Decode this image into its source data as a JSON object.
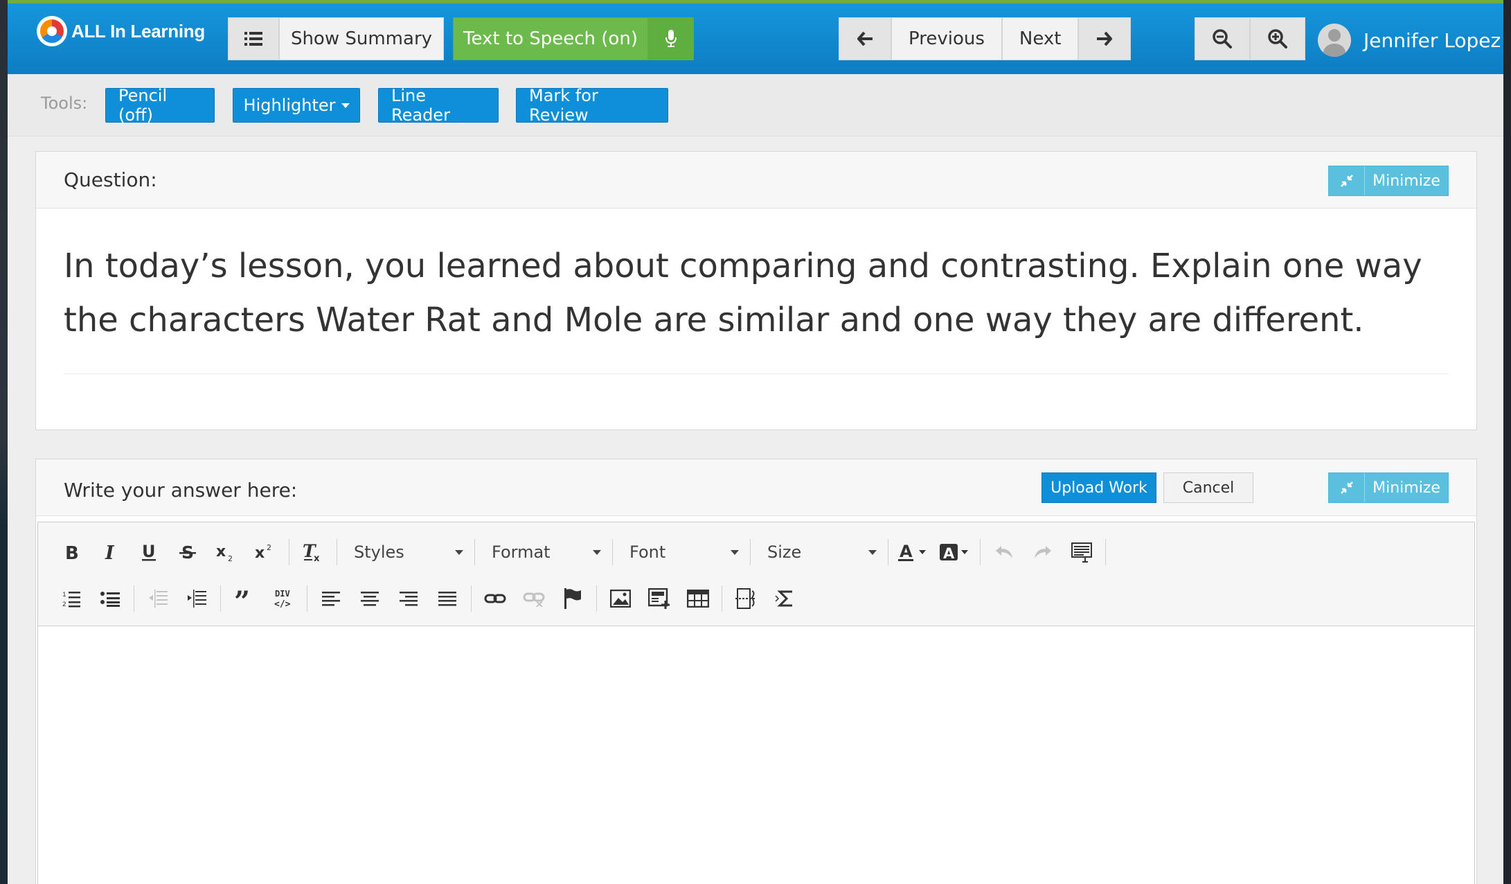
{
  "brand": {
    "name": "ALL In Learning"
  },
  "header": {
    "show_summary_label": "Show Summary",
    "tts_label": "Text to Speech (on)",
    "previous_label": "Previous",
    "next_label": "Next",
    "user_name": "Jennifer Lopez"
  },
  "tools": {
    "label": "Tools:",
    "pencil_label": "Pencil (off)",
    "highlighter_label": "Highlighter",
    "line_reader_label": "Line Reader",
    "mark_review_label": "Mark for Review"
  },
  "question_panel": {
    "title": "Question:",
    "minimize_label": "Minimize",
    "text": "In today’s lesson, you learned about comparing and contrasting. Explain one way the characters Water Rat and Mole are similar and one way they are different."
  },
  "answer_panel": {
    "title": "Write your answer here:",
    "upload_label": "Upload Work",
    "cancel_label": "Cancel",
    "minimize_label": "Minimize"
  },
  "editor": {
    "styles_label": "Styles",
    "format_label": "Format",
    "font_label": "Font",
    "size_label": "Size",
    "content": ""
  },
  "colors": {
    "topbar": "#1596dd",
    "accent_green": "#6cba4c",
    "tool_blue": "#0f8fd8",
    "minimize_cyan": "#5bc0de"
  }
}
